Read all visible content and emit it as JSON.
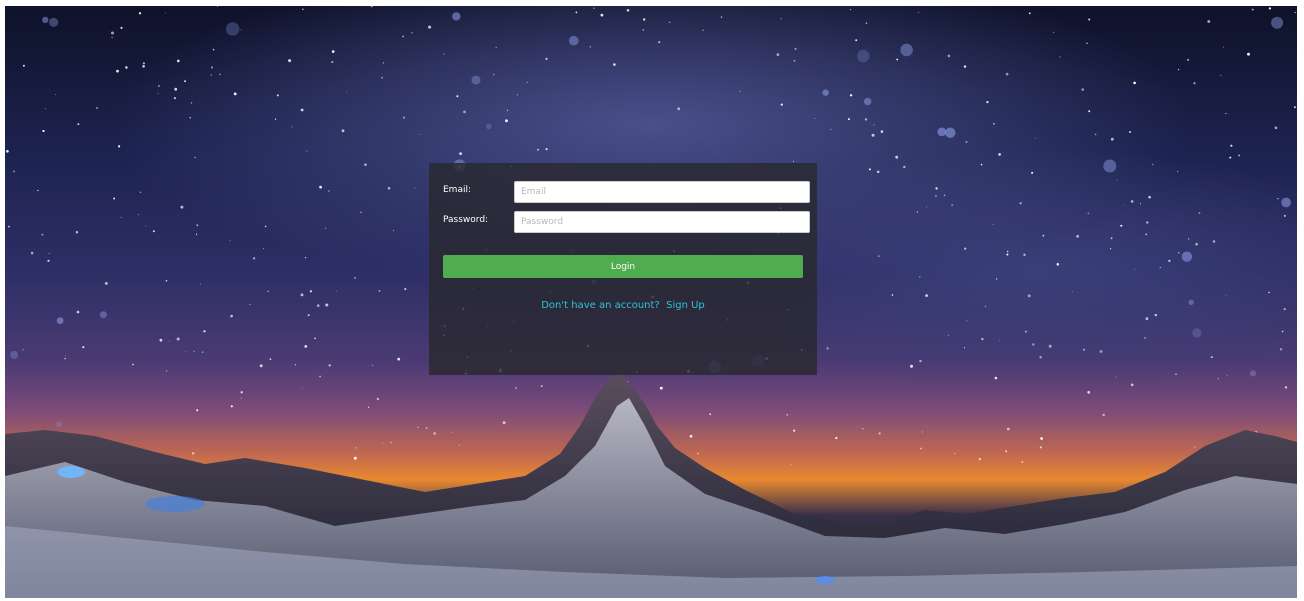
{
  "login_form": {
    "email_label": "Email:",
    "email_placeholder": "Email",
    "email_value": "",
    "password_label": "Password:",
    "password_placeholder": "Password",
    "password_value": "",
    "login_button_label": "Login",
    "signup_prompt": "Don't have an account?",
    "signup_link": "Sign Up"
  },
  "colors": {
    "login_button": "#4fad4f",
    "signup_link": "#2fc2d6",
    "panel_background": "rgba(40,40,48,0.82)"
  }
}
